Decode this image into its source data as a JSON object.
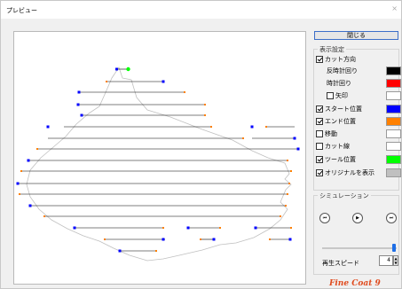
{
  "window": {
    "title": "プレビュー",
    "close_glyph": "×"
  },
  "sidebar": {
    "close_button": "閉じる",
    "display_settings": {
      "label": "表示設定",
      "items": [
        {
          "label": "カット方向",
          "checked": true,
          "indent": 0
        },
        {
          "label": "反時計回り",
          "indent": 1,
          "color": "#000000"
        },
        {
          "label": "時計回り",
          "indent": 1,
          "color": "#ff0000"
        },
        {
          "label": "矢印",
          "checked": false,
          "indent": 1,
          "color": "#ffffff"
        },
        {
          "label": "スタート位置",
          "checked": true,
          "indent": 0,
          "color": "#0000ff"
        },
        {
          "label": "エンド位置",
          "checked": true,
          "indent": 0,
          "color": "#ff8000"
        },
        {
          "label": "移動",
          "checked": false,
          "indent": 0,
          "color": "#ffffff"
        },
        {
          "label": "カット線",
          "checked": false,
          "indent": 0,
          "color": "#ffffff"
        },
        {
          "label": "ツール位置",
          "checked": true,
          "indent": 0,
          "color": "#00ff00"
        },
        {
          "label": "オリジナルを表示",
          "checked": true,
          "indent": 0,
          "color": "#c0c0c0"
        }
      ]
    },
    "simulation": {
      "label": "シミュレーション",
      "speed_label": "再生スピード",
      "speed_value": "4",
      "speed_fraction": 0.95
    }
  },
  "logo": {
    "text": "Fine Coat 9"
  },
  "colors": {
    "start": "#0000ff",
    "end": "#ff8000",
    "tool": "#00ff00",
    "outline": "#c0c0c0",
    "cut": "#000000"
  }
}
